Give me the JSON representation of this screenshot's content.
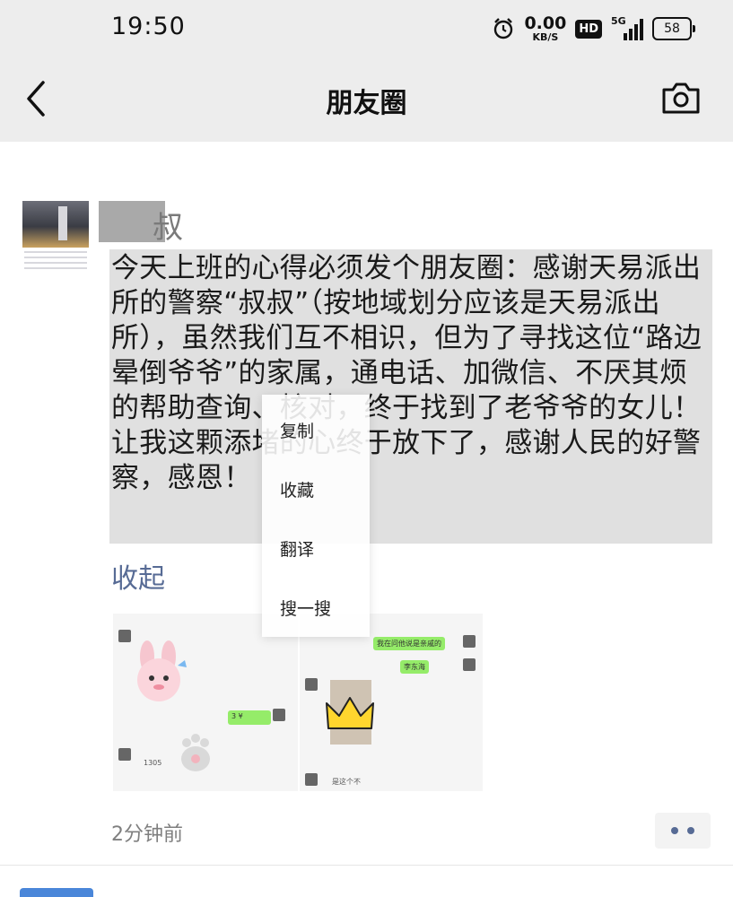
{
  "status_bar": {
    "time": "19:50",
    "speed_value": "0.00",
    "speed_unit": "KB/S",
    "hd_badge": "HD",
    "network": "5G",
    "battery": "58",
    "icons": [
      "alarm-icon",
      "signal-icon",
      "battery-icon"
    ]
  },
  "nav": {
    "title": "朋友圈",
    "icons": [
      "back-chevron-icon",
      "camera-icon"
    ]
  },
  "post": {
    "author_visible_char": "叔",
    "text": "今天上班的心得必须发个朋友圈：感谢天易派出所的警察“叔叔”（按地域划分应该是天易派出所），虽然我们互不相识，但为了寻找这位“路边晕倒爷爷”的家属，通电话、加微信、不厌其烦的帮助查询、核对，终于找到了老爷爷的女儿！让我这颗添堵的心终于放下了，感谢人民的好警察，感恩！",
    "collapse_label": "收起",
    "time_ago": "2分钟前",
    "images": [
      {
        "bubbles": [
          "3 ¥"
        ],
        "caption": "1305"
      },
      {
        "bubbles": [
          "我在问他说是亲戚的",
          "李东海"
        ],
        "caption": "是这个不"
      }
    ]
  },
  "context_menu": {
    "items": [
      "复制",
      "收藏",
      "翻译",
      "搜一搜"
    ]
  },
  "colors": {
    "bar_bg": "#ededed",
    "link": "#576b95",
    "selection": "#e0e0e0",
    "bubble_green": "#95ec69"
  }
}
